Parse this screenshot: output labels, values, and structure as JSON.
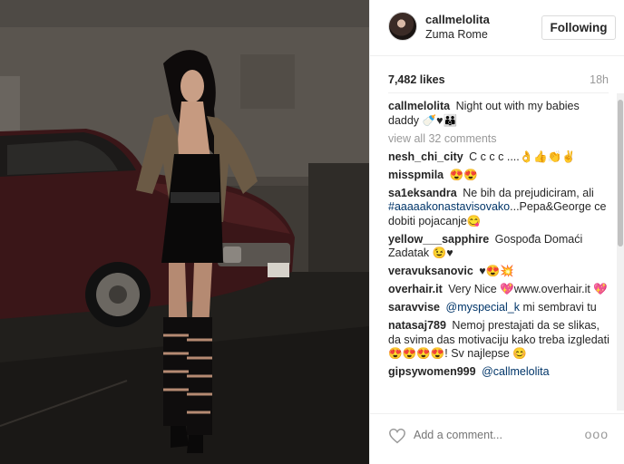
{
  "post": {
    "username": "callmelolita",
    "location": "Zuma Rome",
    "follow_label": "Following",
    "likes": "7,482 likes",
    "age": "18h"
  },
  "caption": {
    "username": "callmelolita",
    "text": "Night out with my babies daddy",
    "emoji": "🍼♥👪"
  },
  "view_all": "view all 32 comments",
  "comments": [
    {
      "user": "nesh_chi_city",
      "text": "C c c c ....👌👍👏✌",
      "mention": ""
    },
    {
      "user": "misspmila",
      "text": "😍😍",
      "mention": ""
    },
    {
      "user": "sa1eksandra",
      "text": "Ne bih da prejudiciram, ali",
      "hashtag": "#aaaaakonastavisovako",
      "tail": "...Pepa&George ce dobiti pojacanje😋"
    },
    {
      "user": "yellow___sapphire",
      "text": "Gospođa Domaći Zadatak 😉♥"
    },
    {
      "user": "veravuksanovic",
      "text": "♥😍💥"
    },
    {
      "user": "overhair.it",
      "text": "Very Nice 💖www.overhair.it 💖"
    },
    {
      "user": "saravvise",
      "mention_text": "@myspecial_k",
      "text": " mi sembravi tu"
    },
    {
      "user": "natasaj789",
      "text": "Nemoj prestajati da se slikas, da svima das motivaciju kako treba izgledati 😍😍😍😍! Sv najlepse 😊"
    },
    {
      "user": "gipsywomen999",
      "mention_text": "@callmelolita",
      "text": ""
    }
  ],
  "footer": {
    "placeholder": "Add a comment...",
    "more": "ooo"
  },
  "colors": {
    "link": "#003569",
    "muted": "#999999",
    "border": "#efefef"
  }
}
